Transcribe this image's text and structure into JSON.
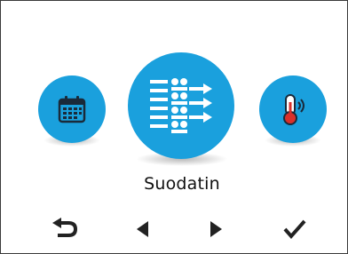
{
  "menu": {
    "current_label": "Suodatin",
    "items": [
      {
        "icon": "calendar-icon",
        "position": "left"
      },
      {
        "icon": "filter-icon",
        "position": "center"
      },
      {
        "icon": "thermometer-icon",
        "position": "right"
      }
    ]
  },
  "nav": {
    "buttons": [
      "back-arrow-icon",
      "arrow-left-icon",
      "arrow-right-icon",
      "checkmark-icon"
    ]
  },
  "colors": {
    "accent": "#1aa0dd",
    "icon_fg": "#ffffff",
    "nav_fg": "#222222",
    "frame": "#3a3a3a"
  }
}
